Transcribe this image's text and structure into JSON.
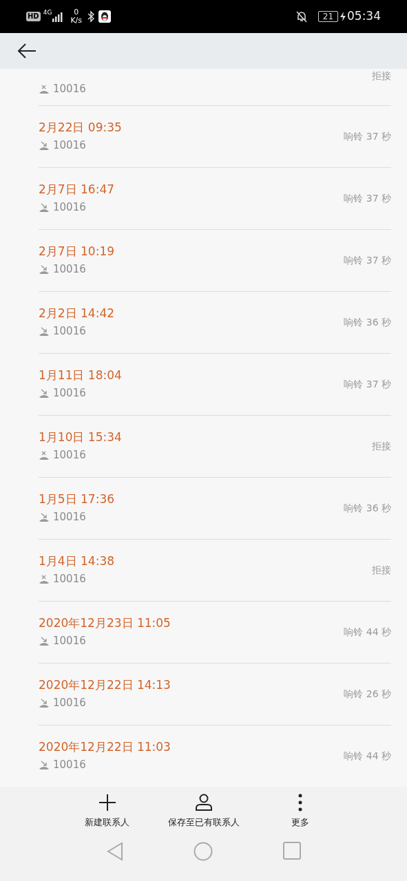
{
  "status_bar": {
    "hd": "HD",
    "network": "4G",
    "speed_value": "0",
    "speed_unit": "K/s",
    "battery": "21",
    "time": "05:34"
  },
  "calls": [
    {
      "kind": "rejected",
      "number": "10016",
      "result": "拒接"
    },
    {
      "kind": "missed",
      "date": "2月22日 09:35",
      "number": "10016",
      "result": "响铃 37 秒"
    },
    {
      "kind": "missed",
      "date": "2月7日 16:47",
      "number": "10016",
      "result": "响铃 37 秒"
    },
    {
      "kind": "missed",
      "date": "2月7日 10:19",
      "number": "10016",
      "result": "响铃 37 秒"
    },
    {
      "kind": "missed",
      "date": "2月2日 14:42",
      "number": "10016",
      "result": "响铃 36 秒"
    },
    {
      "kind": "missed",
      "date": "1月11日 18:04",
      "number": "10016",
      "result": "响铃 37 秒"
    },
    {
      "kind": "rejected",
      "date": "1月10日 15:34",
      "number": "10016",
      "result": "拒接"
    },
    {
      "kind": "missed",
      "date": "1月5日 17:36",
      "number": "10016",
      "result": "响铃 36 秒"
    },
    {
      "kind": "rejected",
      "date": "1月4日 14:38",
      "number": "10016",
      "result": "拒接"
    },
    {
      "kind": "missed",
      "date": "2020年12月23日 11:05",
      "number": "10016",
      "result": "响铃 44 秒"
    },
    {
      "kind": "missed",
      "date": "2020年12月22日 14:13",
      "number": "10016",
      "result": "响铃 26 秒"
    },
    {
      "kind": "missed",
      "date": "2020年12月22日 11:03",
      "number": "10016",
      "result": "响铃 44 秒"
    }
  ],
  "actions": [
    {
      "kind": "add",
      "label": "新建联系人"
    },
    {
      "kind": "person",
      "label": "保存至已有联系人"
    },
    {
      "kind": "more",
      "label": "更多"
    }
  ]
}
